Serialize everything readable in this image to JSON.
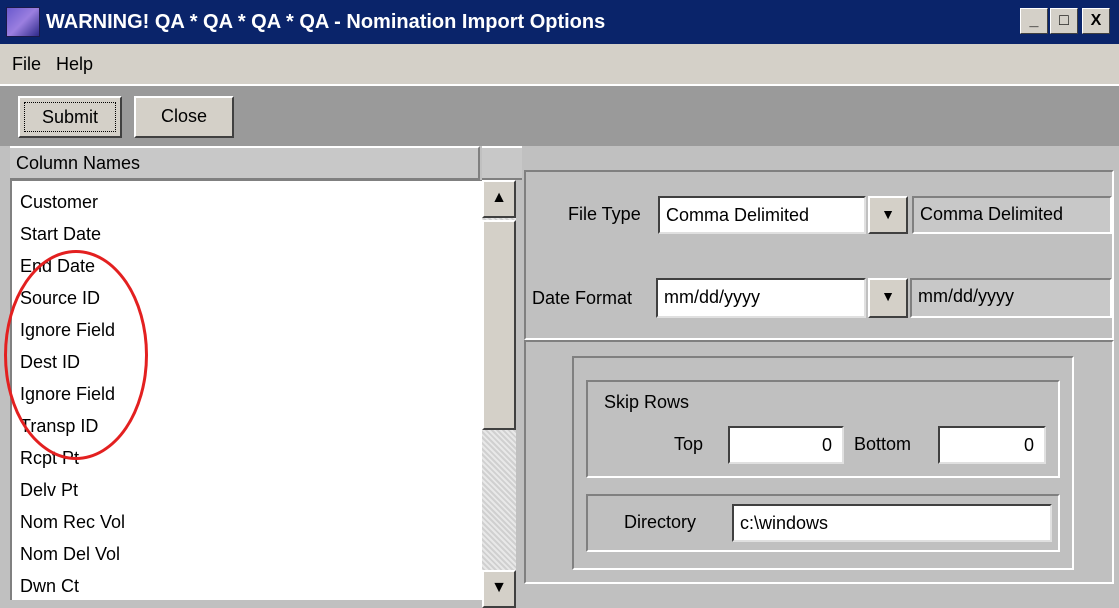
{
  "window": {
    "title": "WARNING!  QA * QA * QA * QA - Nomination Import Options",
    "minimize": "_",
    "maximize": "□",
    "close": "X"
  },
  "menu": {
    "file": "File",
    "help": "Help"
  },
  "toolbar": {
    "submit_label": "Submit",
    "close_label": "Close"
  },
  "column_list": {
    "header": "Column Names",
    "items": [
      "Customer",
      "Start Date",
      "End Date",
      "Source ID",
      "Ignore Field",
      "Dest ID",
      "Ignore Field",
      "Transp ID",
      "Rcpt Pt",
      "Delv Pt",
      "Nom Rec Vol",
      "Nom Del Vol",
      "Dwn Ct"
    ]
  },
  "scrollbar": {
    "up_icon": "▲",
    "down_icon": "▼"
  },
  "file_type": {
    "label": "File Type",
    "value": "Comma Delimited",
    "display": "Comma Delimited",
    "dropdown_icon": "▼"
  },
  "date_format": {
    "label": "Date Format",
    "value": "mm/dd/yyyy",
    "display": "mm/dd/yyyy",
    "dropdown_icon": "▼"
  },
  "skip_rows": {
    "label": "Skip Rows",
    "top_label": "Top",
    "top_value": "0",
    "bottom_label": "Bottom",
    "bottom_value": "0"
  },
  "directory": {
    "label": "Directory",
    "value": "c:\\windows"
  },
  "colors": {
    "titlebar": "#0a246a",
    "annotation": "#e32020",
    "toolbar": "#9a9a9a"
  }
}
